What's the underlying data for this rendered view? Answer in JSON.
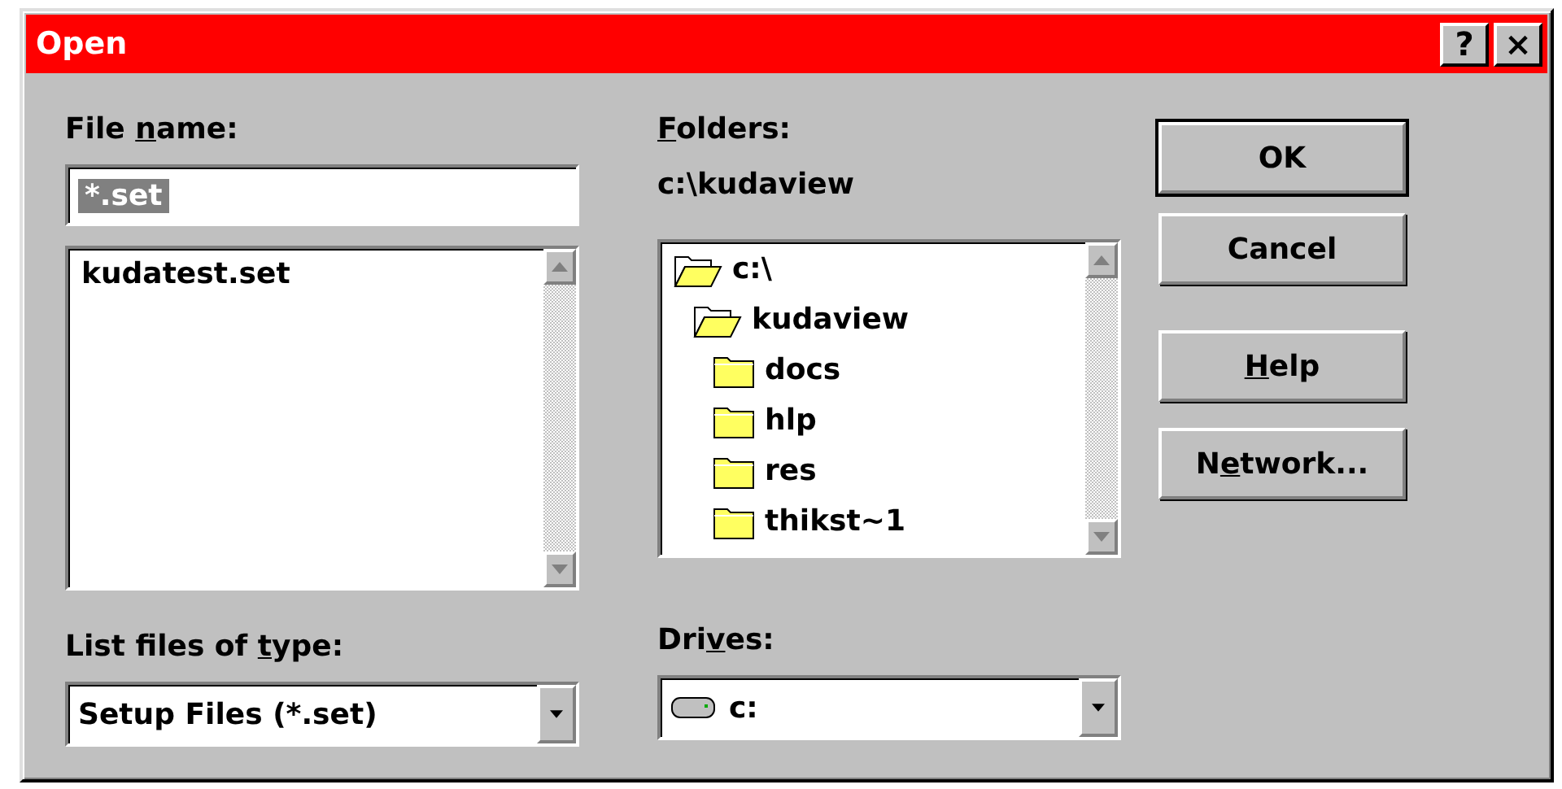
{
  "window": {
    "title": "Open",
    "title_buttons": [
      "?",
      "×"
    ]
  },
  "file_name": {
    "label": {
      "before": "File ",
      "key": "n",
      "after": "ame:"
    },
    "value": "*.set",
    "selected": true,
    "files": [
      "kudatest.set"
    ]
  },
  "file_type": {
    "label": {
      "before": "List files of ",
      "key": "t",
      "after": "ype:"
    },
    "value": "Setup Files (*.set)"
  },
  "folders": {
    "label": {
      "key": "F",
      "after": "olders:"
    },
    "path": "c:\\kudaview",
    "tree": [
      {
        "name": "c:\\",
        "open": true,
        "children": [
          {
            "name": "kudaview",
            "open": true,
            "children": [
              {
                "name": "docs",
                "open": false
              },
              {
                "name": "hlp",
                "open": false
              },
              {
                "name": "res",
                "open": false
              },
              {
                "name": "thikst~1",
                "open": false
              }
            ]
          }
        ]
      }
    ]
  },
  "drives": {
    "label": {
      "before": "Dri",
      "key": "v",
      "after": "es:"
    },
    "value": "c:"
  },
  "buttons": [
    {
      "label": {
        "after": "OK"
      },
      "default": true
    },
    {
      "label": {
        "after": "Cancel"
      },
      "default": false
    },
    {
      "label": {
        "key": "H",
        "after": "elp"
      },
      "default": false
    },
    {
      "label": {
        "before": "N",
        "key": "e",
        "after": "twork..."
      },
      "default": false
    }
  ]
}
